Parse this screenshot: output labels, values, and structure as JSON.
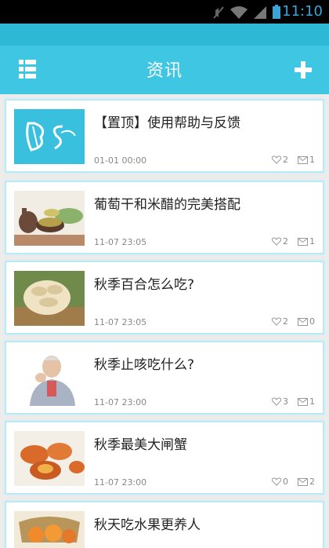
{
  "status_bar": {
    "time": "11:10"
  },
  "app_bar": {
    "title": "资讯"
  },
  "colors": {
    "accent": "#3fc6e2",
    "card_border": "#b9eaf5"
  },
  "articles": [
    {
      "title": "【置顶】使用帮助与反馈",
      "date": "01-01 00:00",
      "likes": "2",
      "comments": "1",
      "thumb": "logo-bs"
    },
    {
      "title": "葡萄干和米醋的完美搭配",
      "date": "11-07 23:05",
      "likes": "2",
      "comments": "1",
      "thumb": "raisins-teapot"
    },
    {
      "title": "秋季百合怎么吃?",
      "date": "11-07 23:05",
      "likes": "2",
      "comments": "0",
      "thumb": "lily-bulbs"
    },
    {
      "title": "秋季止咳吃什么?",
      "date": "11-07 23:00",
      "likes": "3",
      "comments": "1",
      "thumb": "coughing-man"
    },
    {
      "title": "秋季最美大闸蟹",
      "date": "11-07 23:00",
      "likes": "0",
      "comments": "2",
      "thumb": "crabs"
    },
    {
      "title": "秋天吃水果更养人",
      "date": "",
      "likes": "",
      "comments": "",
      "thumb": "fruit-basket"
    }
  ]
}
